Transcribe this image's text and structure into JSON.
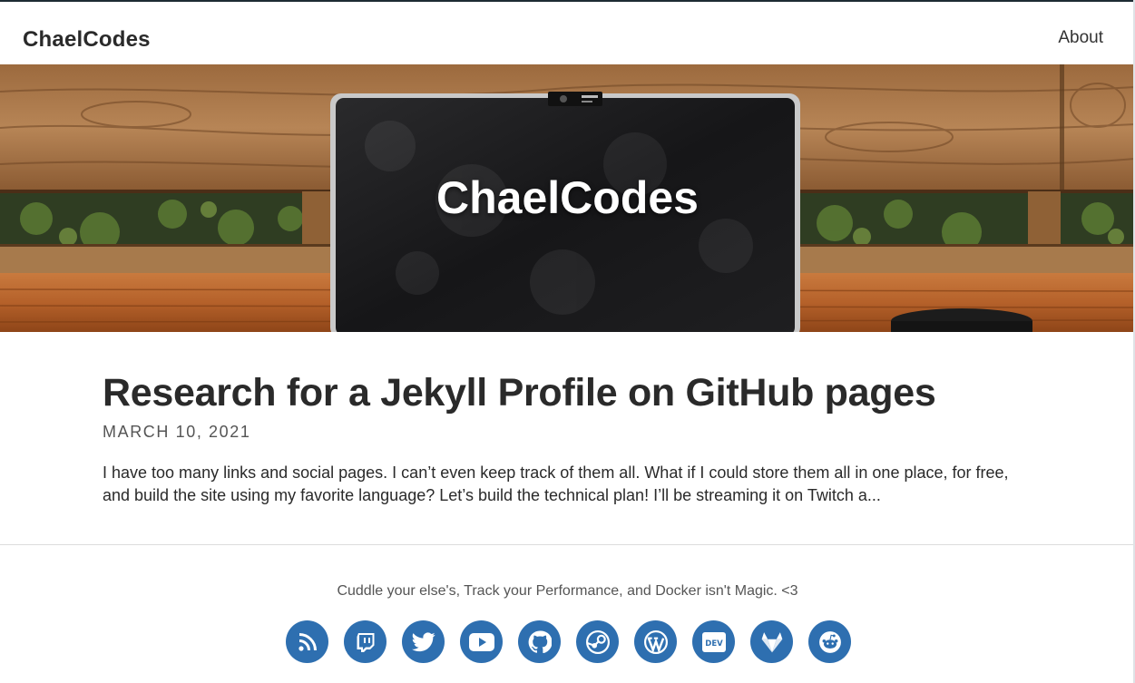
{
  "header": {
    "brand": "ChaelCodes",
    "nav": [
      {
        "label": "About"
      }
    ]
  },
  "hero": {
    "title": "ChaelCodes"
  },
  "post": {
    "title": "Research for a Jekyll Profile on GitHub pages",
    "date": "MARCH 10, 2021",
    "excerpt": "I have too many links and social pages. I can’t even keep track of them all. What if I could store them all in one place, for free, and build the site using my favorite language? Let’s build the technical plan! I’ll be streaming it on Twitch a..."
  },
  "footer": {
    "tagline": "Cuddle your else's, Track your Performance, and Docker isn't Magic. <3",
    "socials": [
      {
        "icon": "rss-icon"
      },
      {
        "icon": "twitch-icon"
      },
      {
        "icon": "twitter-icon"
      },
      {
        "icon": "youtube-icon"
      },
      {
        "icon": "github-icon"
      },
      {
        "icon": "steam-icon"
      },
      {
        "icon": "wordpress-icon"
      },
      {
        "icon": "dev-icon"
      },
      {
        "icon": "gitlab-icon"
      },
      {
        "icon": "reddit-icon"
      }
    ]
  },
  "colors": {
    "social_bg": "#2e6fb0",
    "text": "#2a2a2a"
  }
}
